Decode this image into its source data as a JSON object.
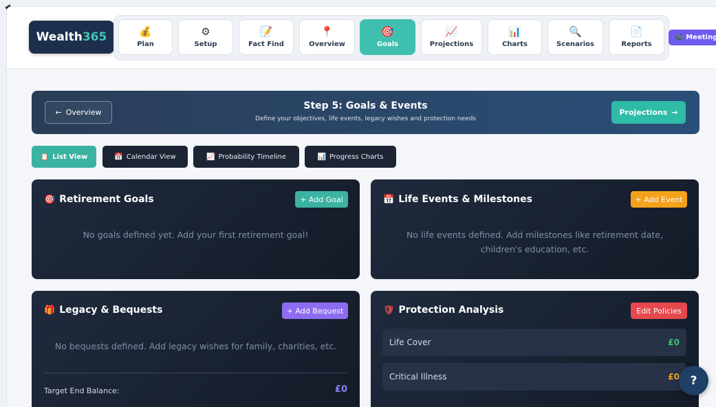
{
  "brand": {
    "name": "Wealth",
    "accent": "365"
  },
  "nav": [
    {
      "label": "Plan",
      "icon": "💰",
      "icon_name": "money-bag-icon",
      "active": false
    },
    {
      "label": "Setup",
      "icon": "⚙",
      "icon_name": "gear-icon",
      "active": false
    },
    {
      "label": "Fact Find",
      "icon": "📝",
      "icon_name": "memo-icon",
      "active": false
    },
    {
      "label": "Overview",
      "icon": "📍",
      "icon_name": "pin-icon",
      "active": false
    },
    {
      "label": "Goals",
      "icon": "🎯",
      "icon_name": "target-icon",
      "active": true
    },
    {
      "label": "Projections",
      "icon": "📈",
      "icon_name": "trend-chart-icon",
      "active": false
    },
    {
      "label": "Charts",
      "icon": "📊",
      "icon_name": "bar-chart-icon",
      "active": false
    },
    {
      "label": "Scenarios",
      "icon": "🔍",
      "icon_name": "magnifier-icon",
      "active": false
    },
    {
      "label": "Reports",
      "icon": "📄",
      "icon_name": "document-icon",
      "active": false
    }
  ],
  "meeting": {
    "label": "Meeting",
    "icon": "📹"
  },
  "step": {
    "back_label": "Overview",
    "back_icon": "←",
    "title": "Step 5: Goals & Events",
    "subtitle": "Define your objectives, life events, legacy wishes and protection needs",
    "next_label": "Projections",
    "next_icon": "→"
  },
  "views": [
    {
      "label": "List View",
      "icon": "📋",
      "active": true
    },
    {
      "label": "Calendar View",
      "icon": "📅",
      "active": false
    },
    {
      "label": "Probability Timeline",
      "icon": "📈",
      "active": false
    },
    {
      "label": "Progress Charts",
      "icon": "📊",
      "active": false
    }
  ],
  "retirement": {
    "icon": "🎯",
    "title": "Retirement Goals",
    "button": "+ Add Goal",
    "empty": "No goals defined yet. Add your first retirement goal!"
  },
  "life_events": {
    "icon": "📅",
    "title": "Life Events & Milestones",
    "button": "+ Add Event",
    "empty": "No life events defined. Add milestones like retirement date, children's education, etc."
  },
  "legacy": {
    "icon": "🎁",
    "title": "Legacy & Bequests",
    "button": "+ Add Bequest",
    "empty": "No bequests defined. Add legacy wishes for family, charities, etc.",
    "balance_label": "Target End Balance:",
    "balance_value": "£0"
  },
  "protection": {
    "icon": "🛡",
    "title": "Protection Analysis",
    "button": "Edit Policies",
    "rows": [
      {
        "label": "Life Cover",
        "value": "£0",
        "color": "#3ec46d"
      },
      {
        "label": "Critical Illness",
        "value": "£0",
        "color": "#f2a024"
      }
    ]
  },
  "help": {
    "label": "?"
  },
  "colors": {
    "accent_teal": "#3fbfae",
    "navy": "#1d2f4d",
    "purple": "#8c7cf5",
    "orange": "#f5a11c",
    "red": "#e5484d"
  }
}
